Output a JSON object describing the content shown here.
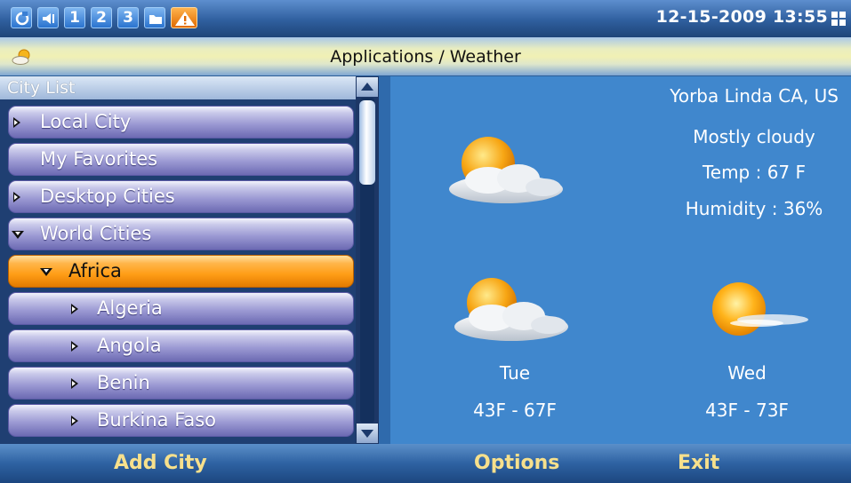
{
  "status_bar": {
    "icons": [
      "sync-icon",
      "volume-icon",
      "line-1-icon",
      "line-2-icon",
      "line-3-icon",
      "folder-icon",
      "alert-icon"
    ],
    "line_labels": [
      "1",
      "2",
      "3"
    ],
    "datetime": "12-15-2009 13:55"
  },
  "title_bar": {
    "icon": "weather-icon",
    "title": "Applications / Weather"
  },
  "city_list": {
    "header": "City List",
    "items": [
      {
        "label": "Local City",
        "indicator": "collapsed"
      },
      {
        "label": "My Favorites",
        "indicator": "none"
      },
      {
        "label": "Desktop Cities",
        "indicator": "collapsed"
      },
      {
        "label": "World Cities",
        "indicator": "expanded"
      },
      {
        "label": "Africa",
        "indicator": "expanded",
        "selected": true
      },
      {
        "label": "Algeria",
        "indicator": "collapsed"
      },
      {
        "label": "Angola",
        "indicator": "collapsed"
      },
      {
        "label": "Benin",
        "indicator": "collapsed"
      },
      {
        "label": "Burkina Faso",
        "indicator": "collapsed"
      }
    ]
  },
  "weather": {
    "location": "Yorba Linda CA, US",
    "current": {
      "condition": "Mostly cloudy",
      "temp": "Temp : 67 F",
      "humidity": "Humidity : 36%",
      "icon": "partly-cloudy-icon"
    },
    "forecast": [
      {
        "day": "Tue",
        "range": "43F - 67F",
        "icon": "partly-cloudy-icon"
      },
      {
        "day": "Wed",
        "range": "43F - 73F",
        "icon": "mostly-sunny-icon"
      }
    ]
  },
  "softkeys": {
    "left": "Add City",
    "center": "Options",
    "right": "Exit"
  },
  "colors": {
    "selected_row": "#ff9d16",
    "list_row": "#9d9bd4",
    "weather_bg": "#4087cd",
    "softkey_text": "#f7e08c"
  }
}
